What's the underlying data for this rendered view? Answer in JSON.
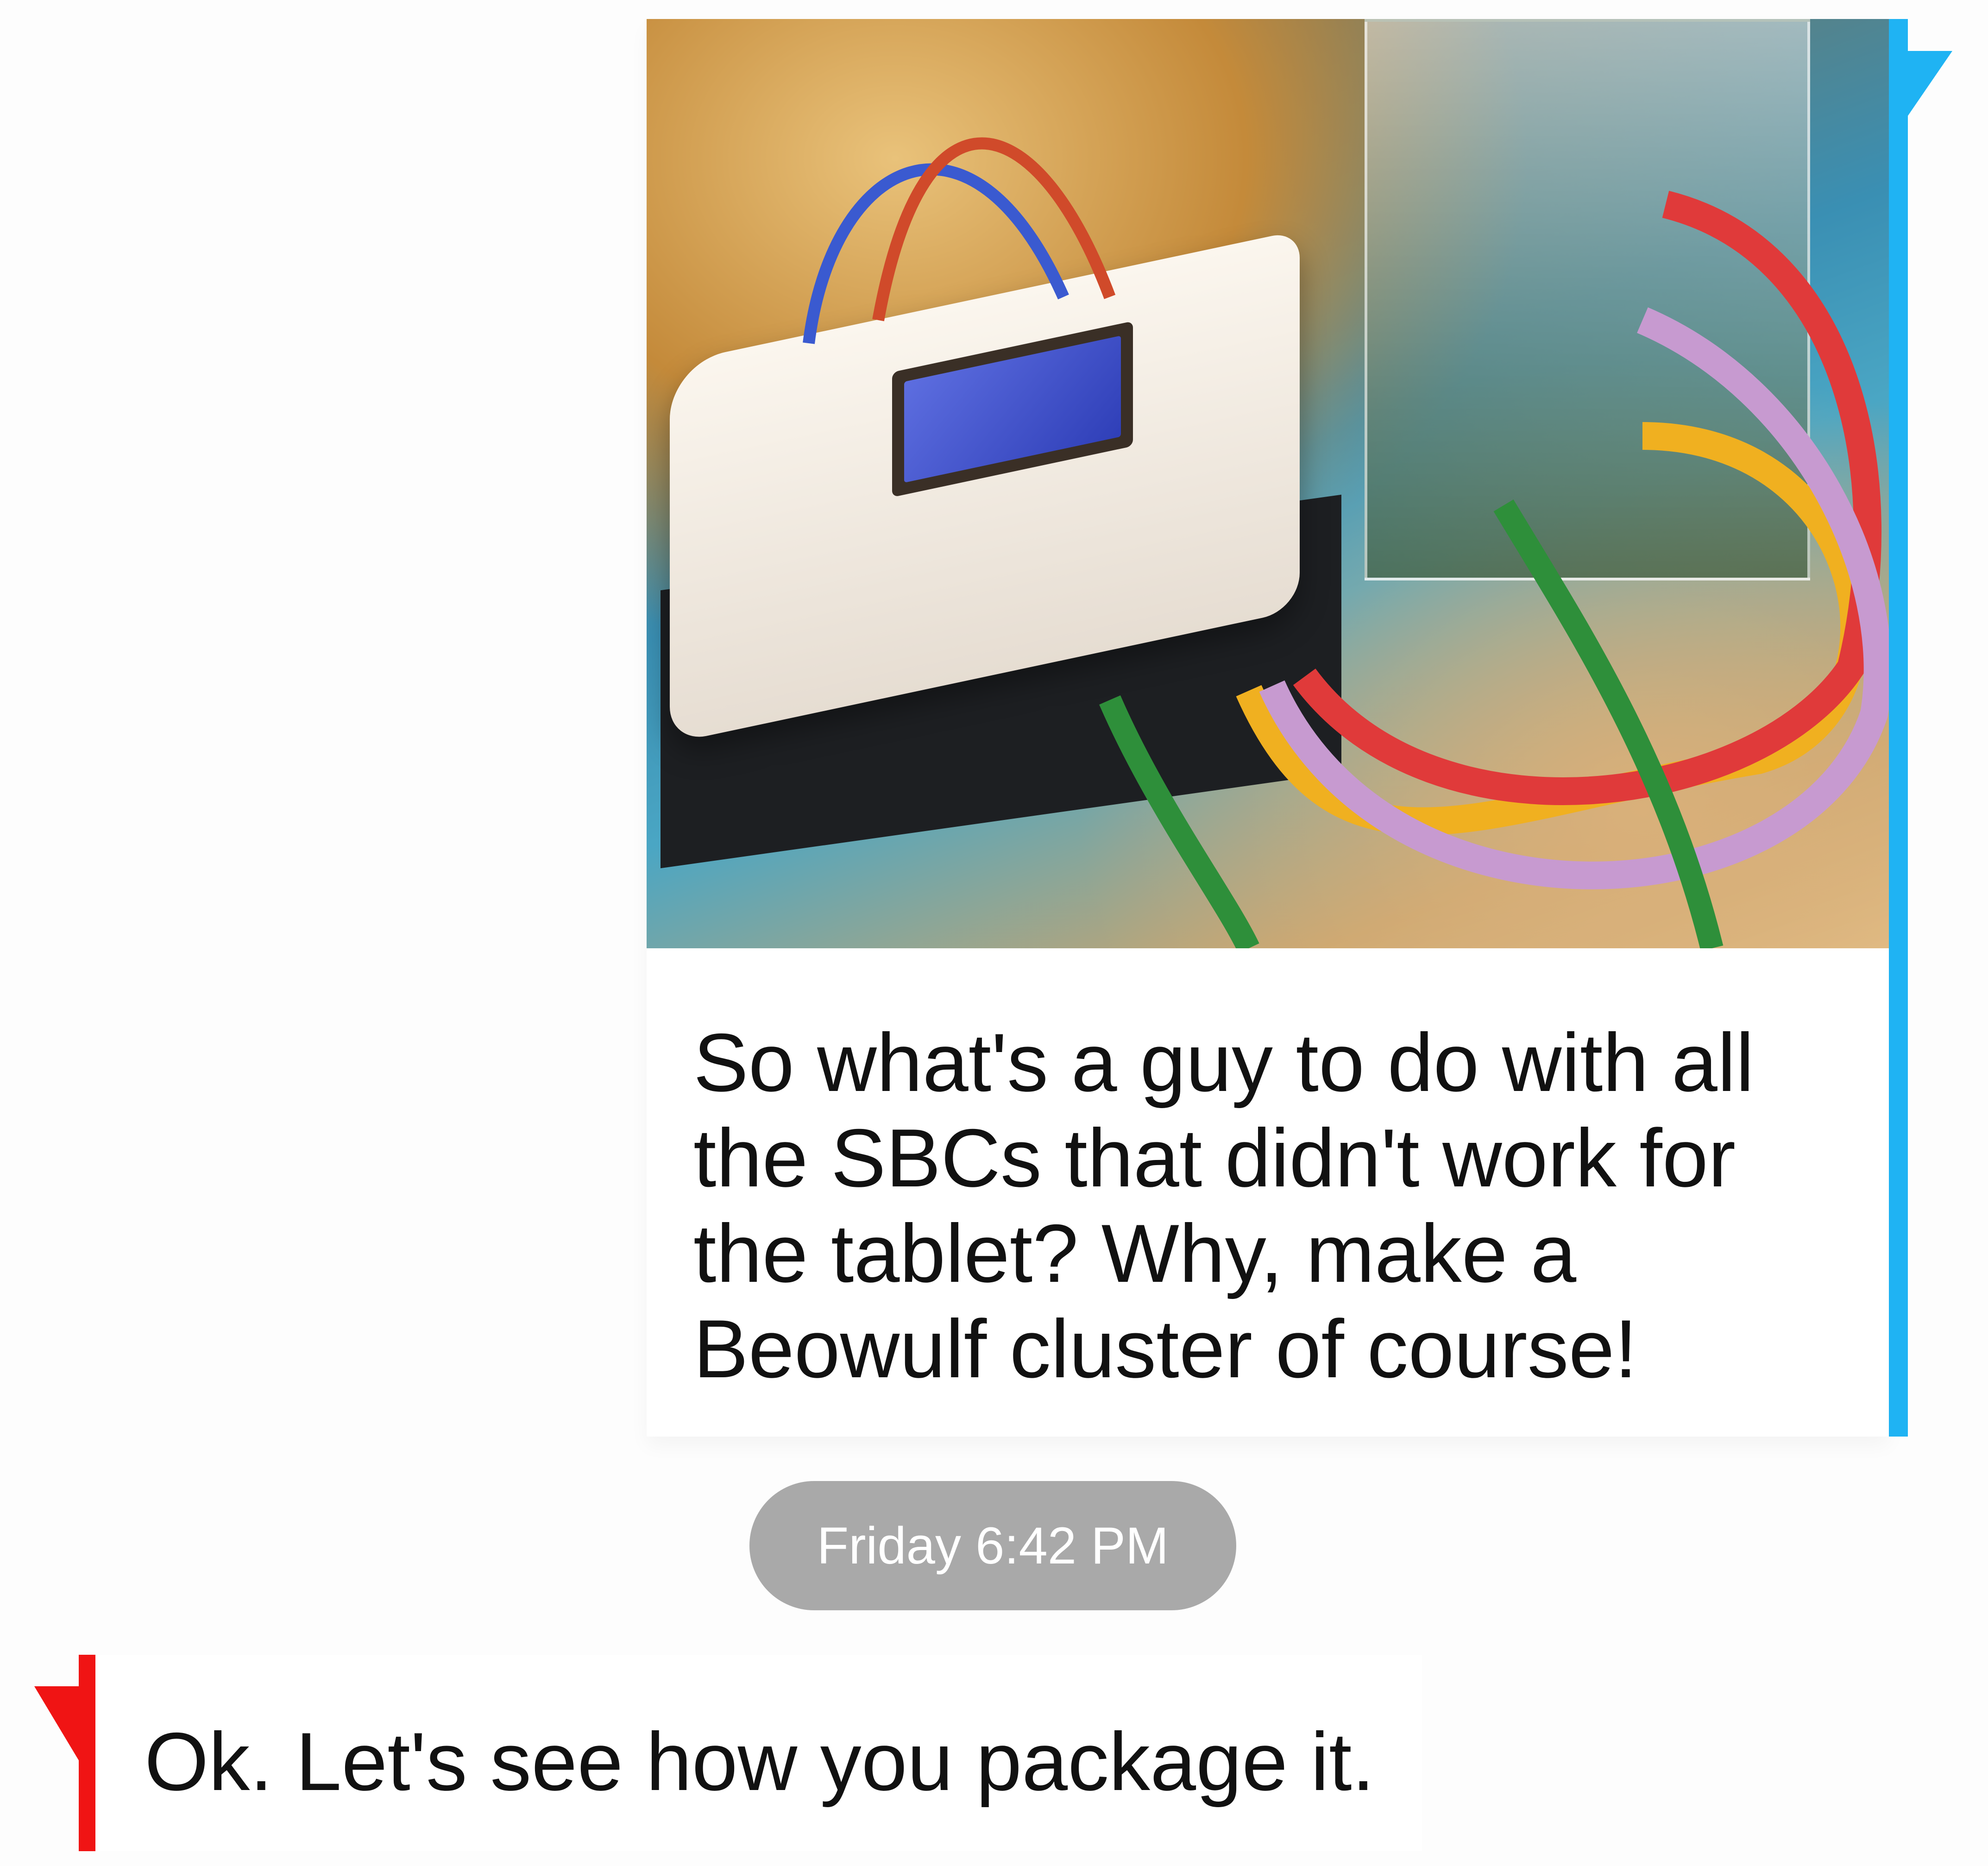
{
  "conversation": {
    "incoming_message": {
      "image_alt": "Photo of SBC Beowulf cluster with USB charger and ethernet cables",
      "text": "So what's a guy to do with all the SBCs that didn't work for the tablet? Why, make a Beowulf cluster of course!",
      "accent_color": "#1fb3f3"
    },
    "timestamp": "Friday 6:42 PM",
    "outgoing_message": {
      "text": "Ok. Let's see how you package it.",
      "accent_color": "#f01414"
    }
  }
}
